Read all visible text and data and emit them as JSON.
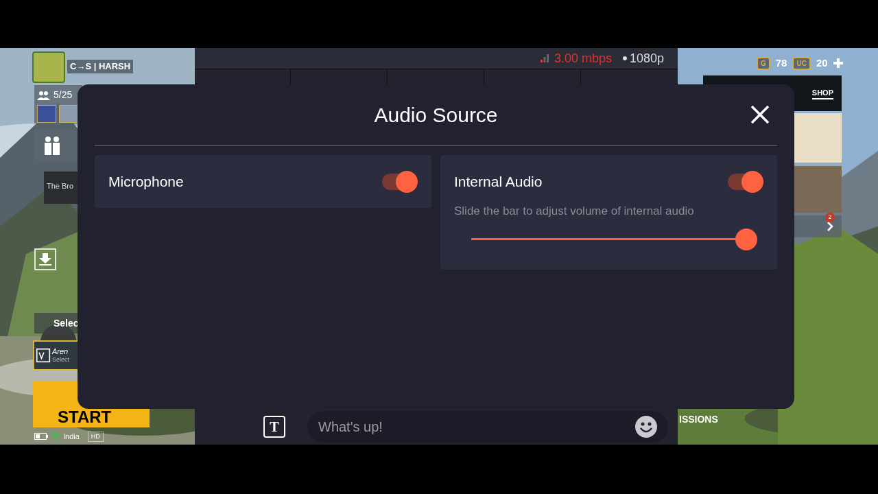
{
  "stream_bar": {
    "bitrate": "3.00 mbps",
    "resolution": "1080p"
  },
  "dialog": {
    "title": "Audio Source",
    "sources": [
      {
        "label": "Microphone",
        "on": true
      },
      {
        "label": "Internal Audio",
        "on": true,
        "hint": "Slide the bar to adjust volume of internal audio",
        "level": 1.0
      }
    ]
  },
  "chat": {
    "format_icon": "T",
    "placeholder": "What's up!"
  },
  "game_hud": {
    "player": "C→S | HARSH",
    "squad": "5/25",
    "crew": "The Bro",
    "mode_button": "Selec",
    "mode": "Aren",
    "mode_sub": "Select",
    "start": "START",
    "region": "India",
    "quality": "HD",
    "currency": [
      {
        "symbol": "G",
        "amount": "78"
      },
      {
        "symbol": "UC",
        "amount": "20"
      }
    ],
    "shop": "SHOP",
    "notifications": "2",
    "missions": "ISSIONS"
  }
}
